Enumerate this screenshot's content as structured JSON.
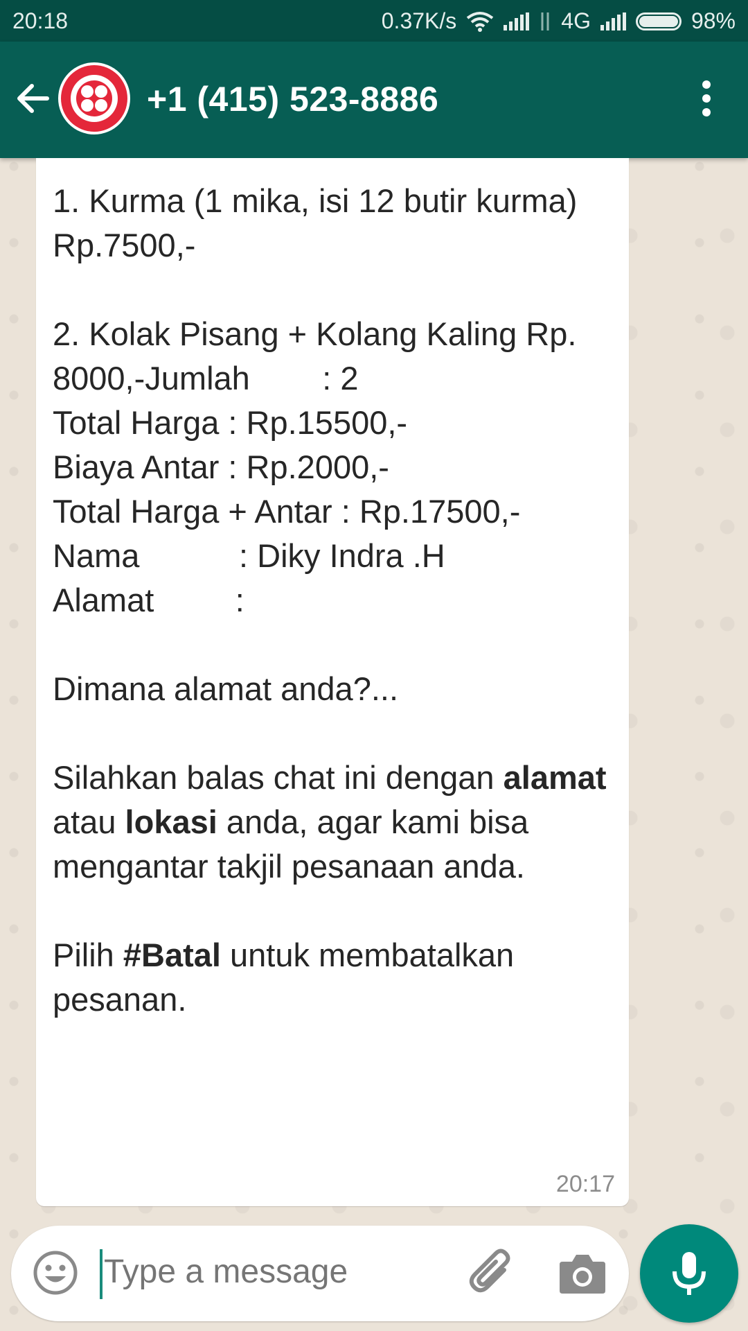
{
  "status_bar": {
    "time": "20:18",
    "net_speed": "0.37K/s",
    "network_type": "4G",
    "battery": "98%"
  },
  "header": {
    "contact": "+1 (415) 523-8886",
    "avatar_icon": "twilio-logo-icon",
    "accent_color": "#075e54"
  },
  "message": {
    "lines": {
      "l1": "1. Kurma (1 mika, isi 12 butir kurma) Rp.7500,-",
      "l2": "2. Kolak Pisang + Kolang Kaling Rp. 8000,-",
      "jumlah": "Jumlah        : 2",
      "total": "Total Harga : Rp.15500,-",
      "biaya": "Biaya Antar : Rp.2000,-",
      "total_antar": "Total Harga + Antar : Rp.17500,-",
      "nama": "Nama           : Diky Indra .H",
      "alamat": "Alamat         :",
      "question": "Dimana alamat anda?...",
      "p1_a": "Silahkan balas chat ini dengan ",
      "p1_b": "alamat",
      "p1_c": " atau ",
      "p1_d": "lokasi",
      "p1_e": " anda, agar kami bisa mengantar takjil pesanaan anda.",
      "p2_a": "Pilih ",
      "p2_b": "#Batal",
      "p2_c": " untuk membatalkan pesanan."
    },
    "time": "20:17"
  },
  "composer": {
    "placeholder": "Type a message",
    "send_color": "#00897b"
  }
}
